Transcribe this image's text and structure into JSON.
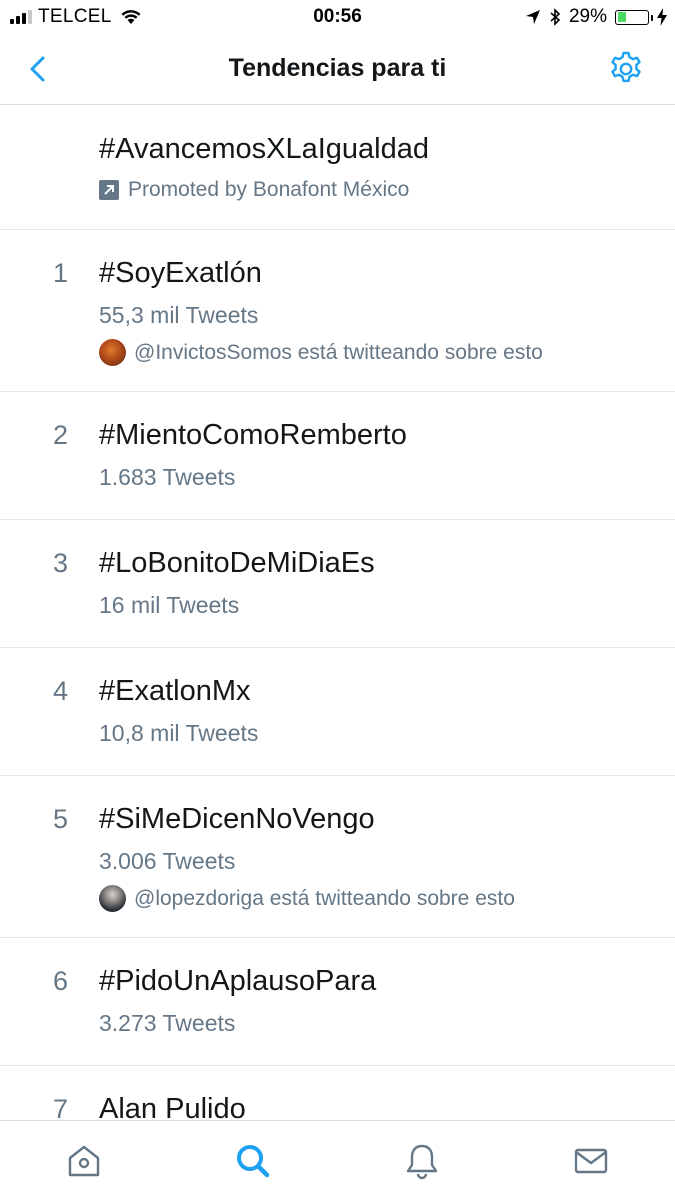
{
  "status_bar": {
    "carrier": "TELCEL",
    "time": "00:56",
    "battery_percent_label": "29%",
    "battery_level": 0.29,
    "icons": [
      "signal-bars-icon",
      "wifi-icon",
      "location-arrow-icon",
      "bluetooth-icon",
      "battery-icon",
      "charging-bolt-icon"
    ]
  },
  "nav": {
    "title": "Tendencias para ti",
    "back_icon": "chevron-left-icon",
    "settings_icon": "gear-icon"
  },
  "promoted": {
    "hashtag": "#AvancemosXLaIgualdad",
    "label": "Promoted by Bonafont México",
    "icon": "promoted-arrow-icon"
  },
  "trends": [
    {
      "rank": "1",
      "name": "#SoyExatlón",
      "count": "55,3 mil Tweets",
      "context": "@InvictosSomos está twitteando sobre esto"
    },
    {
      "rank": "2",
      "name": "#MientoComoRemberto",
      "count": "1.683 Tweets"
    },
    {
      "rank": "3",
      "name": "#LoBonitoDeMiDiaEs",
      "count": "16 mil Tweets"
    },
    {
      "rank": "4",
      "name": "#ExatlonMx",
      "count": "10,8 mil Tweets"
    },
    {
      "rank": "5",
      "name": "#SiMeDicenNoVengo",
      "count": "3.006 Tweets",
      "context": "@lopezdoriga está twitteando sobre esto"
    },
    {
      "rank": "6",
      "name": "#PidoUnAplausoPara",
      "count": "3.273 Tweets"
    },
    {
      "rank": "7",
      "name": "Alan Pulido"
    }
  ],
  "tab_bar": {
    "tabs": [
      "home-icon",
      "search-icon",
      "notifications-bell-icon",
      "messages-envelope-icon"
    ],
    "active": "search-icon"
  },
  "colors": {
    "accent": "#1da1f2",
    "secondary_text": "#657786",
    "primary_text": "#14171a",
    "divider": "#e1e8ed",
    "battery_green": "#4cd964"
  }
}
